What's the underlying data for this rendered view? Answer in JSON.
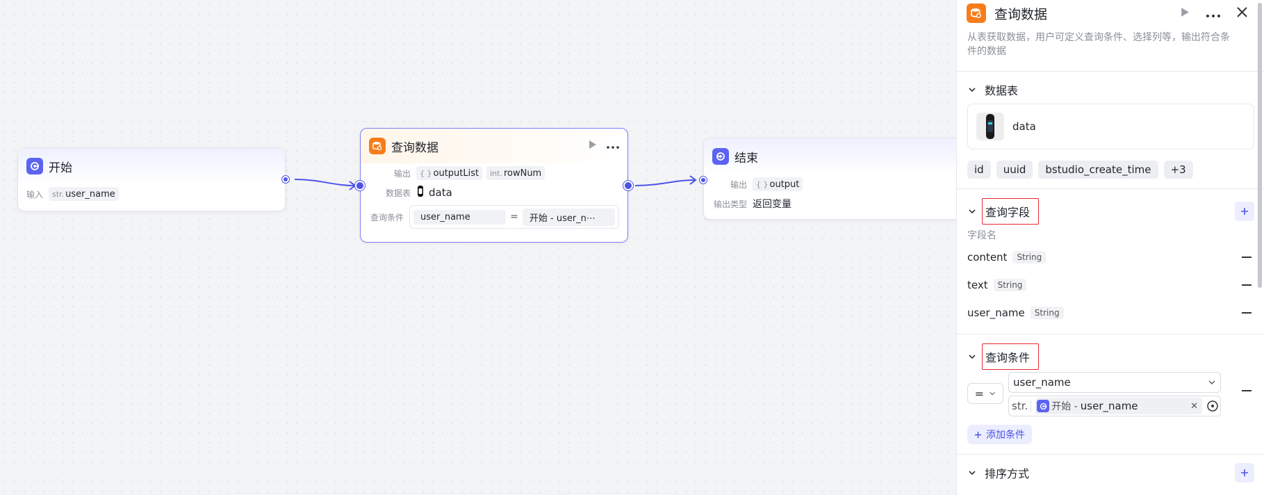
{
  "canvas": {
    "start_node": {
      "title": "开始",
      "input_label": "输入",
      "input_type": "str.",
      "input_name": "user_name"
    },
    "query_node": {
      "title": "查询数据",
      "output_label": "输出",
      "output1_type": "{ }",
      "output1_name": "outputList",
      "output2_type": "int.",
      "output2_name": "rowNum",
      "table_label": "数据表",
      "table_name": "data",
      "condition_label": "查询条件",
      "cond_field": "user_name",
      "cond_op": "=",
      "cond_value": "开始 - user_n⋯"
    },
    "end_node": {
      "title": "结束",
      "output_label": "输出",
      "output_type": "{ }",
      "output_name": "output",
      "output_kind_label": "输出类型",
      "output_kind": "返回变量"
    }
  },
  "panel": {
    "title": "查询数据",
    "description": "从表获取数据，用户可定义查询条件、选择列等，输出符合条件的数据",
    "table_section": {
      "title": "数据表",
      "table_name": "data",
      "columns": [
        "id",
        "uuid",
        "bstudio_create_time",
        "+3"
      ]
    },
    "fields_section": {
      "title": "查询字段",
      "caption": "字段名",
      "fields": [
        {
          "name": "content",
          "type": "String"
        },
        {
          "name": "text",
          "type": "String"
        },
        {
          "name": "user_name",
          "type": "String"
        }
      ]
    },
    "conditions_section": {
      "title": "查询条件",
      "operator": "=",
      "left_field": "user_name",
      "right_prefix": "str.",
      "right_source": "开始 -",
      "right_var": "user_name",
      "add_label": "添加条件"
    },
    "sort_section": {
      "title": "排序方式"
    }
  },
  "colors": {
    "accent": "#4d53e8",
    "node_orange": "#f77d1c",
    "highlight_red": "#e8262f"
  }
}
